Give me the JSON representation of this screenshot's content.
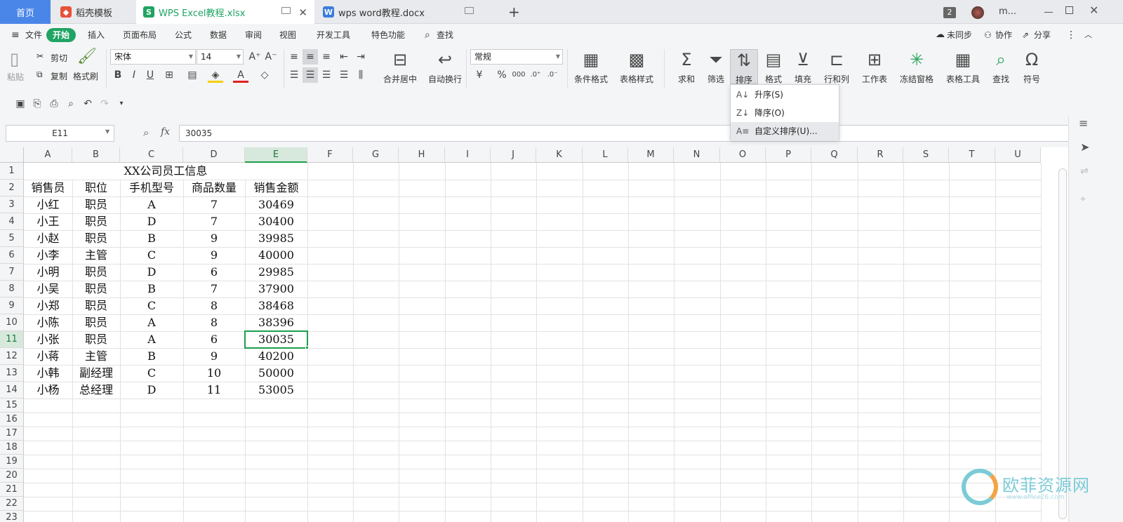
{
  "tabs": [
    {
      "label": "首页",
      "active": false,
      "home": true
    },
    {
      "label": "稻壳模板",
      "icon": "docer-logo-icon"
    },
    {
      "label": "WPS Excel教程.xlsx",
      "icon": "S",
      "active": true
    },
    {
      "label": "wps word教程.docx",
      "icon": "W"
    }
  ],
  "titlebar": {
    "badge": "2",
    "user": "m..."
  },
  "menu": {
    "items": [
      "文件",
      "开始",
      "插入",
      "页面布局",
      "公式",
      "数据",
      "审阅",
      "视图",
      "开发工具",
      "特色功能",
      "查找"
    ],
    "active": "开始",
    "right": [
      "未同步",
      "协作",
      "分享"
    ]
  },
  "ribbon": {
    "paste": "粘贴",
    "cut": "剪切",
    "copy": "复制",
    "format_painter": "格式刷",
    "font_name": "宋体",
    "font_size": "14",
    "merge": "合并居中",
    "wrap": "自动换行",
    "number_format": "常规",
    "cond_format": "条件格式",
    "table_style": "表格样式",
    "sum": "求和",
    "filter": "筛选",
    "sort": "排序",
    "format": "格式",
    "fill": "填充",
    "row_col": "行和列",
    "worksheet": "工作表",
    "freeze": "冻结窗格",
    "table_tools": "表格工具",
    "find": "查找",
    "symbol": "符号"
  },
  "sort_menu": [
    {
      "label": "升序(S)",
      "icon": "sort-asc-icon"
    },
    {
      "label": "降序(O)",
      "icon": "sort-desc-icon"
    },
    {
      "label": "自定义排序(U)...",
      "icon": "custom-sort-icon"
    }
  ],
  "namebox": "E11",
  "formula": "30035",
  "fx_label": "fx",
  "columns": [
    "A",
    "B",
    "C",
    "D",
    "E",
    "F",
    "G",
    "H",
    "I",
    "J",
    "K",
    "L",
    "M",
    "N",
    "O",
    "P",
    "Q",
    "R",
    "S",
    "T",
    "U"
  ],
  "rows": [
    "1",
    "2",
    "3",
    "4",
    "5",
    "6",
    "7",
    "8",
    "9",
    "10",
    "11",
    "12",
    "13",
    "14",
    "15",
    "16",
    "17",
    "18",
    "19",
    "20",
    "21",
    "22",
    "23"
  ],
  "sheet": {
    "title": "XX公司员工信息",
    "headers": [
      "销售员",
      "职位",
      "手机型号",
      "商品数量",
      "销售金额"
    ],
    "data": [
      [
        "小红",
        "职员",
        "A",
        "7",
        "30469"
      ],
      [
        "小王",
        "职员",
        "D",
        "7",
        "30400"
      ],
      [
        "小赵",
        "职员",
        "B",
        "9",
        "39985"
      ],
      [
        "小李",
        "主管",
        "C",
        "9",
        "40000"
      ],
      [
        "小明",
        "职员",
        "D",
        "6",
        "29985"
      ],
      [
        "小吴",
        "职员",
        "B",
        "7",
        "37900"
      ],
      [
        "小郑",
        "职员",
        "C",
        "8",
        "38468"
      ],
      [
        "小陈",
        "职员",
        "A",
        "8",
        "38396"
      ],
      [
        "小张",
        "职员",
        "A",
        "6",
        "30035"
      ],
      [
        "小蒋",
        "主管",
        "B",
        "9",
        "40200"
      ],
      [
        "小韩",
        "副经理",
        "C",
        "10",
        "50000"
      ],
      [
        "小杨",
        "总经理",
        "D",
        "11",
        "53005"
      ]
    ]
  },
  "watermark": {
    "name": "欧菲资源网",
    "url": "www.office26.com"
  },
  "colors": {
    "accent": "#1fa463",
    "tab_bg": "#e8eaed",
    "selected_border": "#1e9e4e"
  }
}
